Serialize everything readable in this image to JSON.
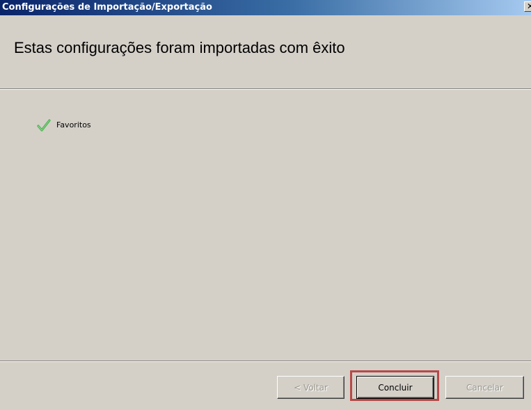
{
  "window": {
    "title": "Configurações de Importação/Exportação",
    "close_glyph": "✕"
  },
  "header": {
    "title": "Estas configurações foram importadas com êxito"
  },
  "results": {
    "items": [
      {
        "label": "Favoritos",
        "status_icon": "check-icon",
        "status_color": "#4cb050"
      }
    ]
  },
  "buttons": {
    "back_label": "< Voltar",
    "finish_label": "Concluir",
    "cancel_label": "Cancelar"
  },
  "colors": {
    "title_bar_start": "#0a246a",
    "title_bar_end": "#a6caf0",
    "dialog_bg": "#d4d0c8",
    "highlight": "#b84848"
  }
}
